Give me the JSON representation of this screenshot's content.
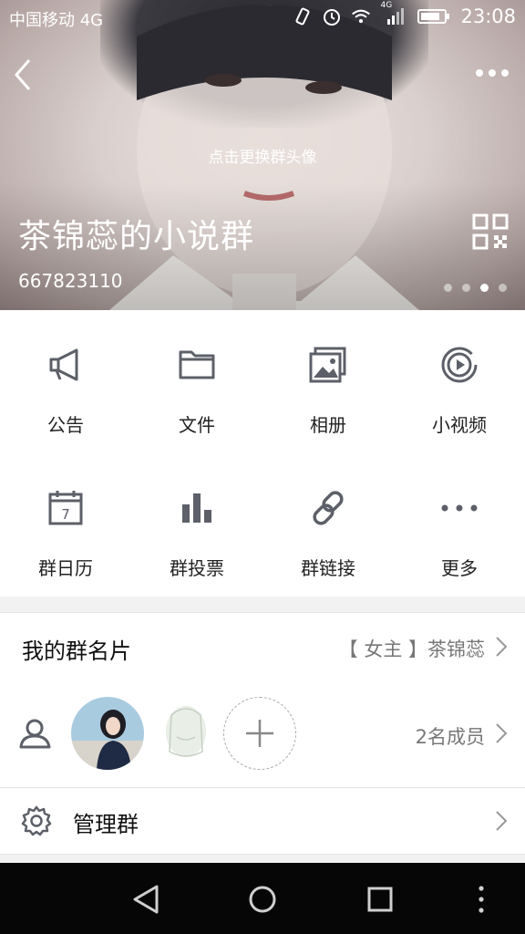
{
  "status_bar": {
    "carrier": "中国移动 4G",
    "network_badge": "4G",
    "time": "23:08",
    "icons": [
      "vibrate-icon",
      "alarm-icon",
      "wifi-icon",
      "signal-icon",
      "battery-icon"
    ]
  },
  "header": {
    "change_avatar": "点击更换群头像",
    "group_name": "茶锦蕊的小说群",
    "group_id": "667823110",
    "carousel": {
      "count": 4,
      "active_index": 2
    },
    "colors": {
      "overlay_text": "#ffffff"
    }
  },
  "features": [
    {
      "icon": "megaphone-icon",
      "label": "公告"
    },
    {
      "icon": "folder-icon",
      "label": "文件"
    },
    {
      "icon": "album-icon",
      "label": "相册"
    },
    {
      "icon": "video-play-icon",
      "label": "小视频"
    },
    {
      "icon": "calendar-icon",
      "label": "群日历",
      "calendar_day": "7"
    },
    {
      "icon": "bar-chart-icon",
      "label": "群投票"
    },
    {
      "icon": "link-icon",
      "label": "群链接"
    },
    {
      "icon": "more-dots-icon",
      "label": "更多"
    }
  ],
  "group_card": {
    "title": "我的群名片",
    "value": "【 女主 】茶锦蕊"
  },
  "members": {
    "count_label": "2名成员"
  },
  "manage": {
    "title": "管理群"
  },
  "colors": {
    "icon_gray": "#5d6068",
    "divider": "#e4e4e4",
    "nav_bg": "#060606"
  }
}
